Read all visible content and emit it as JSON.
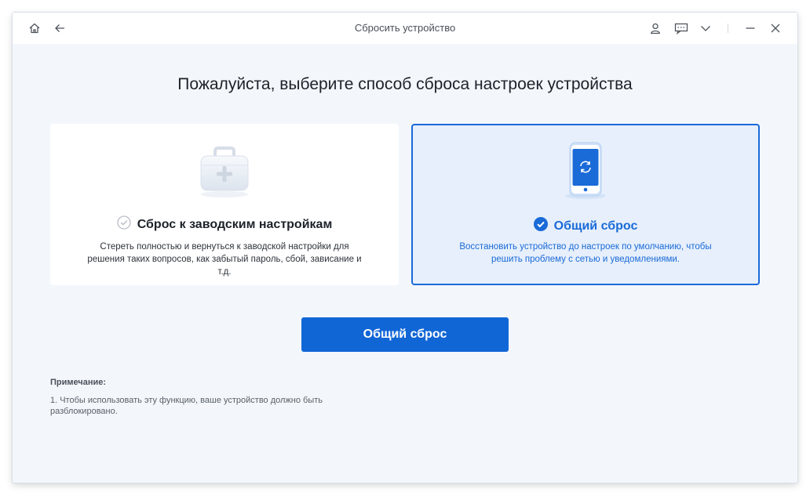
{
  "window": {
    "title": "Сбросить устройство",
    "controls": [
      "home-icon",
      "back-arrow-icon",
      "user-icon",
      "feedback-icon",
      "chevron-down-icon",
      "minimize-icon",
      "close-icon"
    ]
  },
  "main": {
    "heading": "Пожалуйста, выберите способ сброса настроек устройства",
    "options": [
      {
        "icon": "toolbox-icon",
        "title": "Сброс к заводским настройкам",
        "description": "Стереть полностью и вернуться к заводской настройки для решения таких вопросов, как забытый пароль, сбой, зависание и т.д.",
        "selected": false
      },
      {
        "icon": "phone-refresh-icon",
        "title": "Общий сброс",
        "description": "Восстановить устройство до настроек по умолчанию, чтобы решить проблему с сетью и уведомлениями.",
        "selected": true
      }
    ],
    "action_button": "Общий сброс"
  },
  "note": {
    "title": "Примечание:",
    "text": "1. Чтобы использовать эту функцию, ваше устройство должно быть разблокировано."
  },
  "colors": {
    "accent": "#1166d6",
    "selected_border": "#1a6ad8",
    "selected_bg": "#e6effb",
    "window_bg": "#f3f7fc"
  }
}
